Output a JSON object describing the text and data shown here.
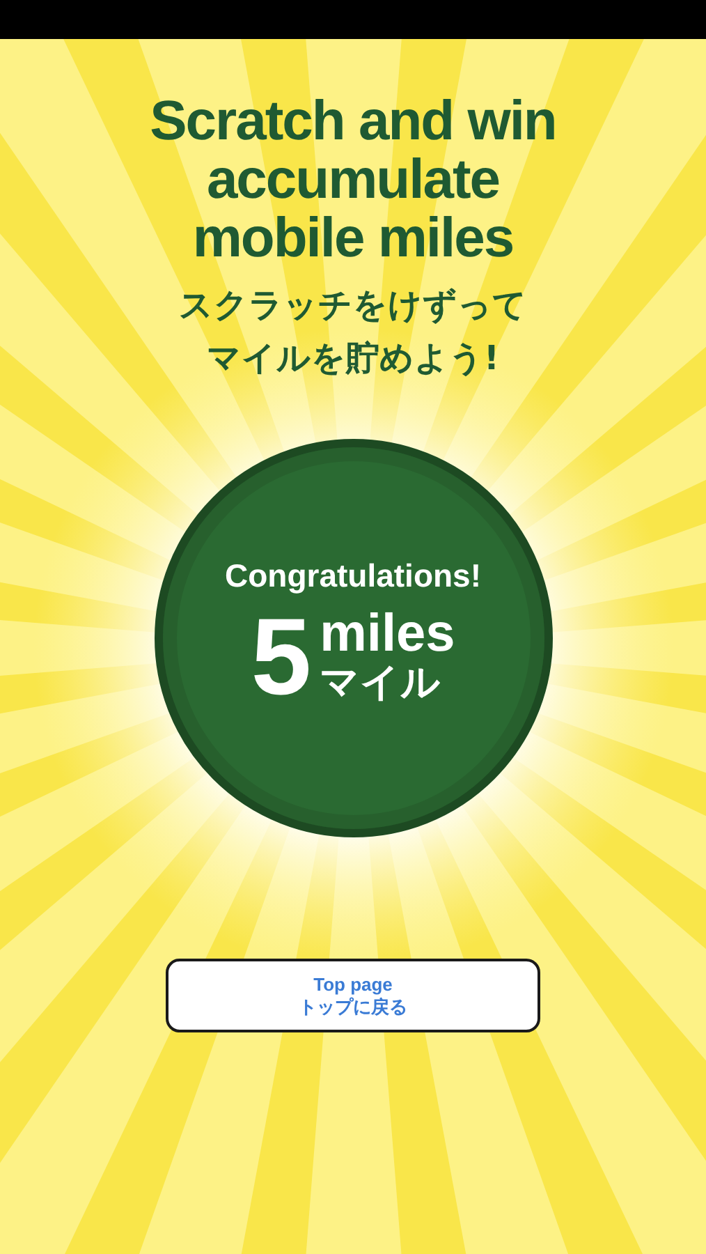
{
  "title_lines": [
    "Scratch and win",
    "accumulate",
    "mobile miles"
  ],
  "subtitle_lines": [
    "スクラッチをけずって",
    "マイルを貯めよう!"
  ],
  "result": {
    "heading": "Congratulations!",
    "amount": "5",
    "unit": "miles",
    "unit_ja": "マイル"
  },
  "button": {
    "label": "Top page",
    "label_ja": "トップに戻る"
  }
}
